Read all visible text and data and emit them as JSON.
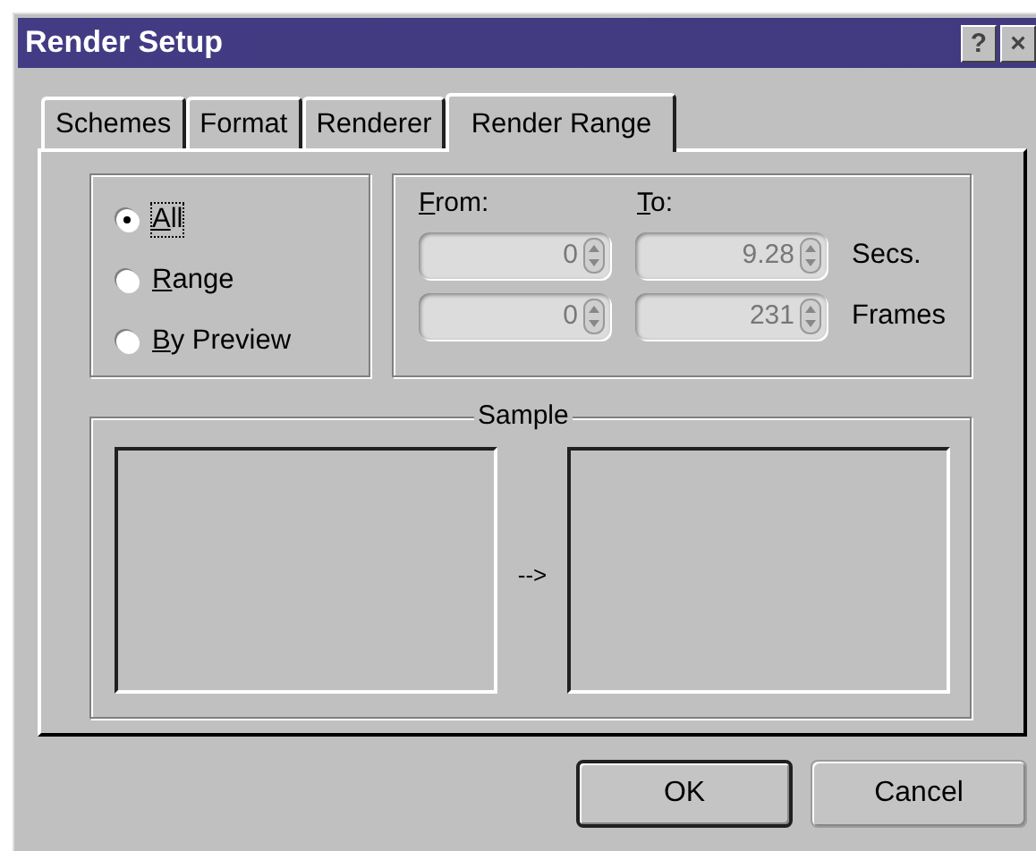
{
  "window": {
    "title": "Render Setup",
    "help_button": "?",
    "close_button": "×"
  },
  "tabs": [
    {
      "label": "Schemes",
      "selected": false
    },
    {
      "label": "Format",
      "selected": false
    },
    {
      "label": "Renderer",
      "selected": false
    },
    {
      "label": "Render Range",
      "selected": true
    }
  ],
  "range_options": [
    {
      "label": "All",
      "selected": true,
      "focused": true
    },
    {
      "label": "Range",
      "selected": false,
      "focused": false
    },
    {
      "label": "By Preview",
      "selected": false,
      "focused": false
    }
  ],
  "from_label": {
    "text": "From:"
  },
  "to_label": {
    "text": "To:"
  },
  "rows": [
    {
      "from": "0",
      "to": "9.28",
      "unit": "Secs.",
      "disabled": true
    },
    {
      "from": "0",
      "to": "231",
      "unit": "Frames",
      "disabled": true
    }
  ],
  "sample": {
    "title": "Sample",
    "arrow": "-->"
  },
  "buttons": [
    {
      "label": "OK",
      "default": true
    },
    {
      "label": "Cancel",
      "default": false
    }
  ]
}
